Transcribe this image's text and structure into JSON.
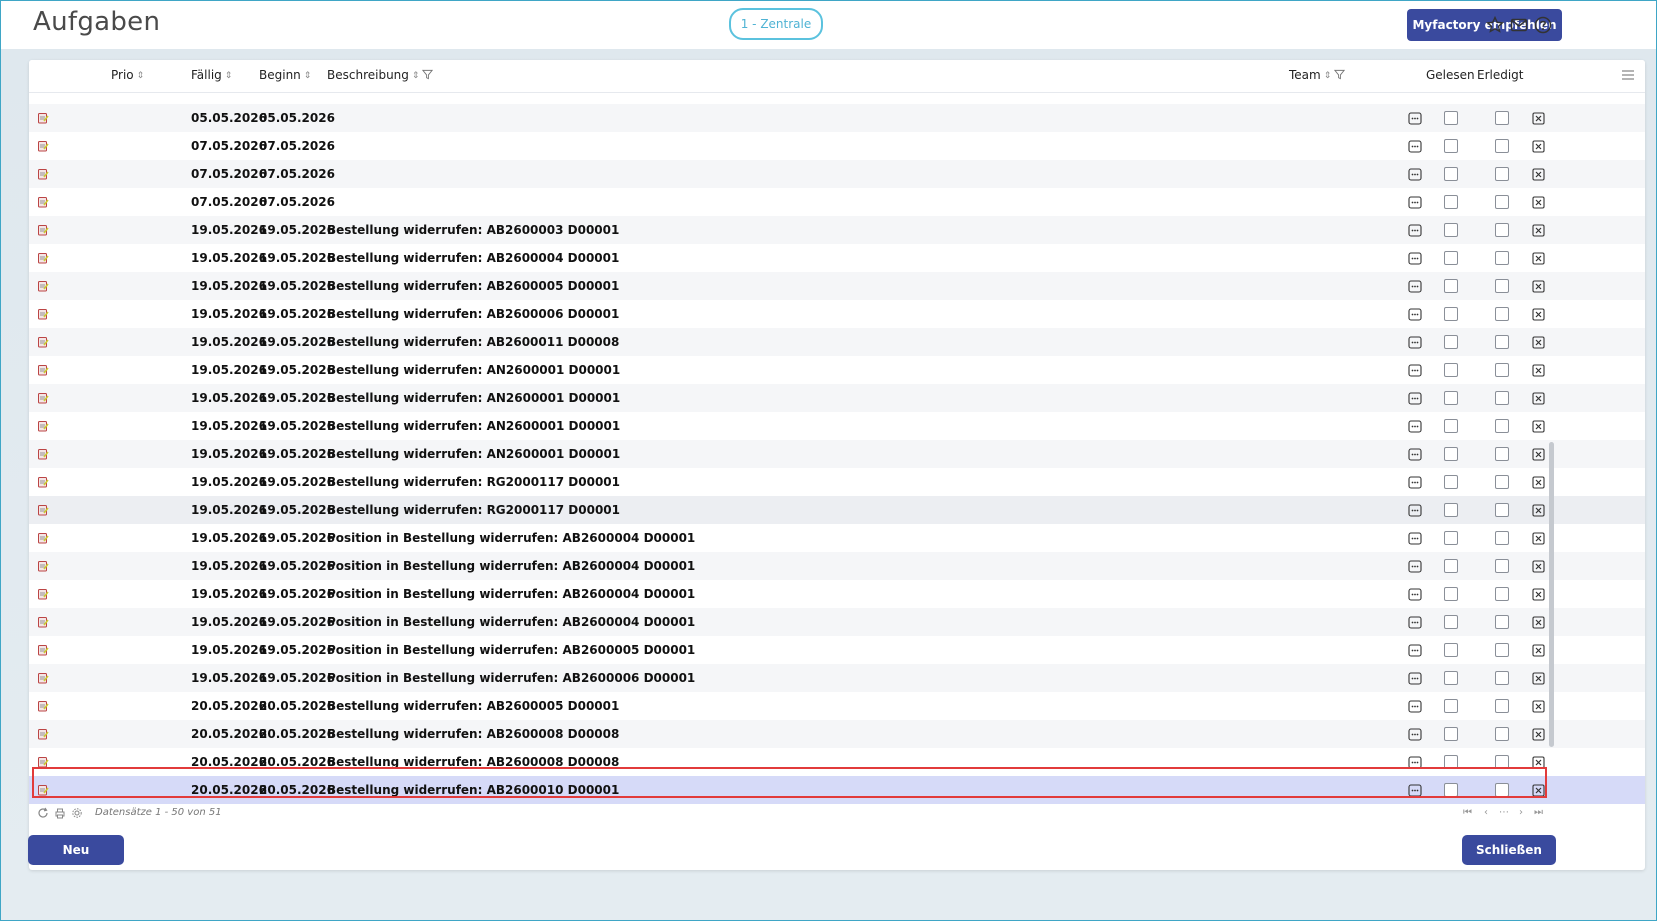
{
  "app": {
    "title": "Aufgaben",
    "tenant": "1 - Zentrale",
    "recommend_label": "Myfactory empfehlen"
  },
  "top_icons": [
    "star-icon",
    "mail-icon",
    "help-icon"
  ],
  "columns": {
    "prio": "Prio",
    "faellig": "Fällig",
    "beginn": "Beginn",
    "beschreibung": "Beschreibung",
    "team": "Team",
    "gelesen": "Gelesen",
    "erledigt": "Erledigt"
  },
  "rows": [
    {
      "faellig": "05.05.2026",
      "beginn": "05.05.2026",
      "beschreibung": ""
    },
    {
      "faellig": "07.05.2026",
      "beginn": "07.05.2026",
      "beschreibung": ""
    },
    {
      "faellig": "07.05.2026",
      "beginn": "07.05.2026",
      "beschreibung": ""
    },
    {
      "faellig": "07.05.2026",
      "beginn": "07.05.2026",
      "beschreibung": ""
    },
    {
      "faellig": "19.05.2026",
      "beginn": "19.05.2026",
      "beschreibung": "Bestellung widerrufen: AB2600003 D00001"
    },
    {
      "faellig": "19.05.2026",
      "beginn": "19.05.2026",
      "beschreibung": "Bestellung widerrufen: AB2600004 D00001"
    },
    {
      "faellig": "19.05.2026",
      "beginn": "19.05.2026",
      "beschreibung": "Bestellung widerrufen: AB2600005 D00001"
    },
    {
      "faellig": "19.05.2026",
      "beginn": "19.05.2026",
      "beschreibung": "Bestellung widerrufen: AB2600006 D00001"
    },
    {
      "faellig": "19.05.2026",
      "beginn": "19.05.2026",
      "beschreibung": "Bestellung widerrufen: AB2600011 D00008"
    },
    {
      "faellig": "19.05.2026",
      "beginn": "19.05.2026",
      "beschreibung": "Bestellung widerrufen: AN2600001 D00001"
    },
    {
      "faellig": "19.05.2026",
      "beginn": "19.05.2026",
      "beschreibung": "Bestellung widerrufen: AN2600001 D00001"
    },
    {
      "faellig": "19.05.2026",
      "beginn": "19.05.2026",
      "beschreibung": "Bestellung widerrufen: AN2600001 D00001"
    },
    {
      "faellig": "19.05.2026",
      "beginn": "19.05.2026",
      "beschreibung": "Bestellung widerrufen: AN2600001 D00001"
    },
    {
      "faellig": "19.05.2026",
      "beginn": "19.05.2026",
      "beschreibung": "Bestellung widerrufen: RG2000117 D00001"
    },
    {
      "faellig": "19.05.2026",
      "beginn": "19.05.2026",
      "beschreibung": "Bestellung widerrufen: RG2000117 D00001"
    },
    {
      "faellig": "19.05.2026",
      "beginn": "19.05.2026",
      "beschreibung": "Position in Bestellung widerrufen: AB2600004 D00001"
    },
    {
      "faellig": "19.05.2026",
      "beginn": "19.05.2026",
      "beschreibung": "Position in Bestellung widerrufen: AB2600004 D00001"
    },
    {
      "faellig": "19.05.2026",
      "beginn": "19.05.2026",
      "beschreibung": "Position in Bestellung widerrufen: AB2600004 D00001"
    },
    {
      "faellig": "19.05.2026",
      "beginn": "19.05.2026",
      "beschreibung": "Position in Bestellung widerrufen: AB2600004 D00001"
    },
    {
      "faellig": "19.05.2026",
      "beginn": "19.05.2026",
      "beschreibung": "Position in Bestellung widerrufen: AB2600005 D00001"
    },
    {
      "faellig": "19.05.2026",
      "beginn": "19.05.2026",
      "beschreibung": "Position in Bestellung widerrufen: AB2600006 D00001"
    },
    {
      "faellig": "20.05.2026",
      "beginn": "20.05.2026",
      "beschreibung": "Bestellung widerrufen: AB2600005 D00001"
    },
    {
      "faellig": "20.05.2026",
      "beginn": "20.05.2026",
      "beschreibung": "Bestellung widerrufen: AB2600008 D00008"
    },
    {
      "faellig": "20.05.2026",
      "beginn": "20.05.2026",
      "beschreibung": "Bestellung widerrufen: AB2600008 D00008"
    },
    {
      "faellig": "20.05.2026",
      "beginn": "20.05.2026",
      "beschreibung": "Bestellung widerrufen: AB2600010 D00001"
    }
  ],
  "footer": {
    "records_text": "Datensätze 1 - 50 von 51"
  },
  "buttons": {
    "new_label": "Neu",
    "close_label": "Schließen"
  }
}
